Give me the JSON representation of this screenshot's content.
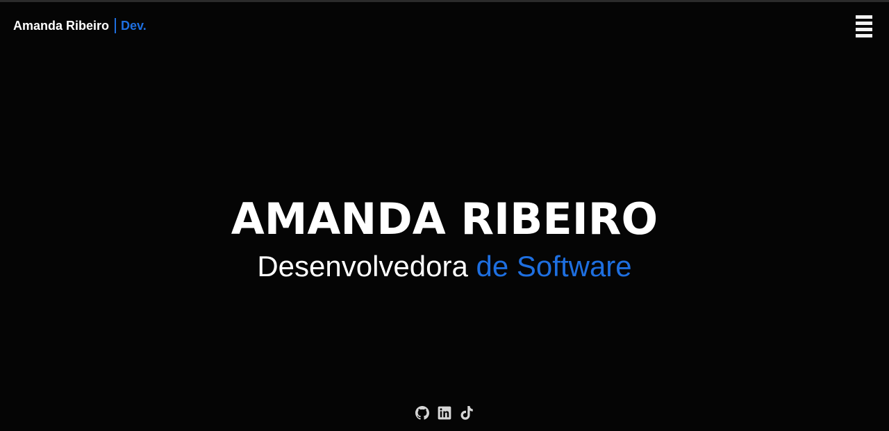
{
  "navbar": {
    "brand_name": "Amanda Ribeiro",
    "brand_suffix": "Dev.",
    "menu_icon": "hamburger-menu-icon"
  },
  "hero": {
    "title": "AMANDA RIBEIRO",
    "subtitle_main": "Desenvolvedora",
    "subtitle_accent": "de Software"
  },
  "socials": [
    {
      "icon": "github-icon"
    },
    {
      "icon": "linkedin-icon"
    },
    {
      "icon": "tiktok-icon"
    }
  ],
  "colors": {
    "background": "#050505",
    "accent": "#1e6fe0",
    "text": "#ffffff",
    "icon": "#d6d6d6"
  }
}
